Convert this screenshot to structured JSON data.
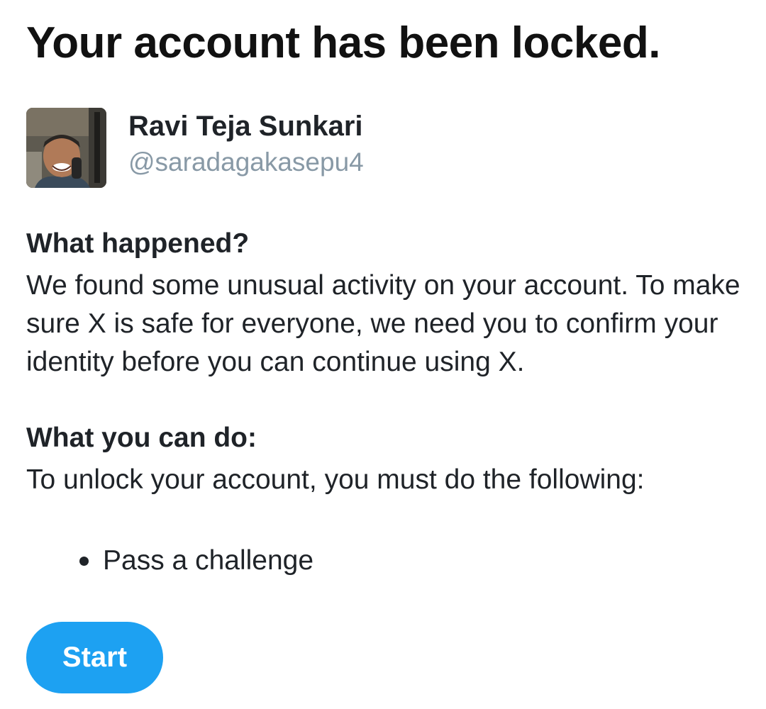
{
  "page": {
    "title": "Your account has been locked."
  },
  "account": {
    "display_name": "Ravi Teja Sunkari",
    "handle": "@saradagakasepu4",
    "avatar_icon": "profile-photo"
  },
  "what_happened": {
    "heading": "What happened?",
    "text": "We found some unusual activity on your account. To make sure X is safe for everyone, we need you to confirm your identity before you can continue using X."
  },
  "what_you_can_do": {
    "heading": "What you can do:",
    "text": "To unlock your account, you must do the following:",
    "steps": [
      "Pass a challenge"
    ]
  },
  "actions": {
    "start_label": "Start"
  },
  "colors": {
    "accent": "#1da1f2",
    "text": "#1f2328",
    "muted": "#8899a6",
    "background": "#ffffff"
  }
}
